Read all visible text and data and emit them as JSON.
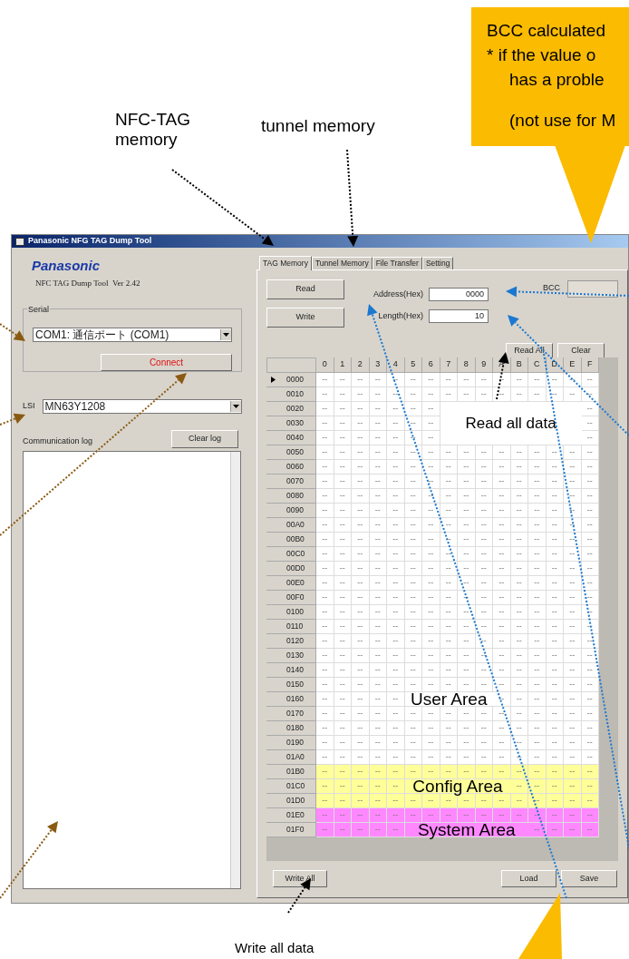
{
  "window": {
    "title": "Panasonic NFG TAG Dump Tool",
    "logo": "Panasonic",
    "version": "NFC TAG Dump Tool  Ver 2.42",
    "serial": {
      "label": "Serial",
      "port": "COM1: 通信ポート (COM1)"
    },
    "connect_button": "Connect",
    "lsi": {
      "label": "LSI",
      "value": "MN63Y1208"
    },
    "log": {
      "label": "Communication log",
      "clear_button": "Clear log"
    },
    "tabs": [
      {
        "label": "TAG Memory",
        "selected": true
      },
      {
        "label": "Tunnel Memory",
        "selected": false
      },
      {
        "label": "File Transfer",
        "selected": false
      },
      {
        "label": "Setting",
        "selected": false
      }
    ],
    "read_button": "Read",
    "write_button": "Write",
    "address": {
      "label": "Address(Hex)",
      "value": "0000"
    },
    "length": {
      "label": "Length(Hex)",
      "value": "10"
    },
    "bcc": {
      "label": "BCC"
    },
    "read_all_button": "Read All",
    "clear_button": "Clear",
    "grid": {
      "columns": [
        "0",
        "1",
        "2",
        "3",
        "4",
        "5",
        "6",
        "7",
        "8",
        "9",
        "A",
        "B",
        "C",
        "D",
        "E",
        "F"
      ],
      "rows": [
        {
          "address": "0000",
          "selected": true,
          "kind": "user",
          "cells": [
            "--",
            "--",
            "--",
            "--",
            "--",
            "--",
            "--",
            "--",
            "--",
            "--",
            "--",
            "--",
            "--",
            "--",
            "--",
            "--"
          ]
        },
        {
          "address": "0010",
          "selected": false,
          "kind": "user",
          "cells": [
            "--",
            "--",
            "--",
            "--",
            "--",
            "--",
            "--",
            "--",
            "--",
            "--",
            "--",
            "--",
            "--",
            "--",
            "--",
            "--"
          ]
        },
        {
          "address": "0020",
          "selected": false,
          "kind": "user",
          "cells": [
            "--",
            "--",
            "--",
            "--",
            "--",
            "--",
            "--",
            null,
            null,
            null,
            null,
            null,
            null,
            null,
            null,
            "--"
          ]
        },
        {
          "address": "0030",
          "selected": false,
          "kind": "user",
          "cells": [
            "--",
            "--",
            "--",
            "--",
            "--",
            "--",
            "--",
            null,
            null,
            null,
            null,
            null,
            null,
            null,
            null,
            "--"
          ]
        },
        {
          "address": "0040",
          "selected": false,
          "kind": "user",
          "cells": [
            "--",
            "--",
            "--",
            "--",
            "--",
            "--",
            "--",
            null,
            null,
            null,
            null,
            null,
            null,
            null,
            null,
            "--"
          ]
        },
        {
          "address": "0050",
          "selected": false,
          "kind": "user",
          "cells": [
            "--",
            "--",
            "--",
            "--",
            "--",
            "--",
            "--",
            "--",
            "--",
            "--",
            "--",
            "--",
            "--",
            "--",
            "--",
            "--"
          ]
        },
        {
          "address": "0060",
          "selected": false,
          "kind": "user",
          "cells": [
            "--",
            "--",
            "--",
            "--",
            "--",
            "--",
            "--",
            "--",
            "--",
            "--",
            "--",
            "--",
            "--",
            "--",
            "--",
            "--"
          ]
        },
        {
          "address": "0070",
          "selected": false,
          "kind": "user",
          "cells": [
            "--",
            "--",
            "--",
            "--",
            "--",
            "--",
            "--",
            "--",
            "--",
            "--",
            "--",
            "--",
            "--",
            "--",
            "--",
            "--"
          ]
        },
        {
          "address": "0080",
          "selected": false,
          "kind": "user",
          "cells": [
            "--",
            "--",
            "--",
            "--",
            "--",
            "--",
            "--",
            "--",
            "--",
            "--",
            "--",
            "--",
            "--",
            "--",
            "--",
            "--"
          ]
        },
        {
          "address": "0090",
          "selected": false,
          "kind": "user",
          "cells": [
            "--",
            "--",
            "--",
            "--",
            "--",
            "--",
            "--",
            "--",
            "--",
            "--",
            "--",
            "--",
            "--",
            "--",
            "--",
            "--"
          ]
        },
        {
          "address": "00A0",
          "selected": false,
          "kind": "user",
          "cells": [
            "--",
            "--",
            "--",
            "--",
            "--",
            "--",
            "--",
            "--",
            "--",
            "--",
            "--",
            "--",
            "--",
            "--",
            "--",
            "--"
          ]
        },
        {
          "address": "00B0",
          "selected": false,
          "kind": "user",
          "cells": [
            "--",
            "--",
            "--",
            "--",
            "--",
            "--",
            "--",
            "--",
            "--",
            "--",
            "--",
            "--",
            "--",
            "--",
            "--",
            "--"
          ]
        },
        {
          "address": "00C0",
          "selected": false,
          "kind": "user",
          "cells": [
            "--",
            "--",
            "--",
            "--",
            "--",
            "--",
            "--",
            "--",
            "--",
            "--",
            "--",
            "--",
            "--",
            "--",
            "--",
            "--"
          ]
        },
        {
          "address": "00D0",
          "selected": false,
          "kind": "user",
          "cells": [
            "--",
            "--",
            "--",
            "--",
            "--",
            "--",
            "--",
            "--",
            "--",
            "--",
            "--",
            "--",
            "--",
            "--",
            "--",
            "--"
          ]
        },
        {
          "address": "00E0",
          "selected": false,
          "kind": "user",
          "cells": [
            "--",
            "--",
            "--",
            "--",
            "--",
            "--",
            "--",
            "--",
            "--",
            "--",
            "--",
            "--",
            "--",
            "--",
            "--",
            "--"
          ]
        },
        {
          "address": "00F0",
          "selected": false,
          "kind": "user",
          "cells": [
            "--",
            "--",
            "--",
            "--",
            "--",
            "--",
            "--",
            "--",
            "--",
            "--",
            "--",
            "--",
            "--",
            "--",
            "--",
            "--"
          ]
        },
        {
          "address": "0100",
          "selected": false,
          "kind": "user",
          "cells": [
            "--",
            "--",
            "--",
            "--",
            "--",
            "--",
            "--",
            "--",
            "--",
            "--",
            "--",
            "--",
            "--",
            "--",
            "--",
            "--"
          ]
        },
        {
          "address": "0110",
          "selected": false,
          "kind": "user",
          "cells": [
            "--",
            "--",
            "--",
            "--",
            "--",
            "--",
            "--",
            "--",
            "--",
            "--",
            "--",
            "--",
            "--",
            "--",
            "--",
            "--"
          ]
        },
        {
          "address": "0120",
          "selected": false,
          "kind": "user",
          "cells": [
            "--",
            "--",
            "--",
            "--",
            "--",
            "--",
            "--",
            "--",
            "--",
            "--",
            "--",
            "--",
            "--",
            "--",
            "--",
            "--"
          ]
        },
        {
          "address": "0130",
          "selected": false,
          "kind": "user",
          "cells": [
            "--",
            "--",
            "--",
            "--",
            "--",
            "--",
            "--",
            "--",
            "--",
            "--",
            "--",
            "--",
            "--",
            "--",
            "--",
            "--"
          ]
        },
        {
          "address": "0140",
          "selected": false,
          "kind": "user",
          "cells": [
            "--",
            "--",
            "--",
            "--",
            "--",
            "--",
            "--",
            "--",
            "--",
            "--",
            "--",
            "--",
            "--",
            "--",
            "--",
            "--"
          ]
        },
        {
          "address": "0150",
          "selected": false,
          "kind": "user",
          "cells": [
            "--",
            "--",
            "--",
            "--",
            "--",
            "--",
            "--",
            "--",
            "--",
            "--",
            "--",
            "--",
            "--",
            "--",
            "--",
            "--"
          ]
        },
        {
          "address": "0160",
          "selected": false,
          "kind": "user",
          "cells": [
            "--",
            "--",
            "--",
            "--",
            "--",
            null,
            null,
            null,
            null,
            null,
            "--",
            "--",
            "--",
            "--",
            "--",
            "--"
          ]
        },
        {
          "address": "0170",
          "selected": false,
          "kind": "user",
          "cells": [
            "--",
            "--",
            "--",
            "--",
            "--",
            "--",
            "--",
            "--",
            "--",
            "--",
            "--",
            "--",
            "--",
            "--",
            "--",
            "--"
          ]
        },
        {
          "address": "0180",
          "selected": false,
          "kind": "user",
          "cells": [
            "--",
            "--",
            "--",
            "--",
            "--",
            "--",
            "--",
            "--",
            "--",
            "--",
            "--",
            "--",
            "--",
            "--",
            "--",
            "--"
          ]
        },
        {
          "address": "0190",
          "selected": false,
          "kind": "user",
          "cells": [
            "--",
            "--",
            "--",
            "--",
            "--",
            "--",
            "--",
            "--",
            "--",
            "--",
            "--",
            "--",
            "--",
            "--",
            "--",
            "--"
          ]
        },
        {
          "address": "01A0",
          "selected": false,
          "kind": "user",
          "cells": [
            "--",
            "--",
            "--",
            "--",
            "--",
            "--",
            "--",
            "--",
            "--",
            "--",
            "--",
            "--",
            "--",
            "--",
            "--",
            "--"
          ]
        },
        {
          "address": "01B0",
          "selected": false,
          "kind": "config",
          "cells": [
            "--",
            "--",
            "--",
            "--",
            "--",
            "--",
            "--",
            "--",
            "--",
            "--",
            "--",
            "--",
            "--",
            "--",
            "--",
            "--"
          ]
        },
        {
          "address": "01C0",
          "selected": false,
          "kind": "config",
          "cells": [
            "--",
            "--",
            "--",
            "--",
            "--",
            null,
            null,
            null,
            null,
            null,
            null,
            "--",
            "--",
            "--",
            "--",
            "--"
          ]
        },
        {
          "address": "01D0",
          "selected": false,
          "kind": "config",
          "cells": [
            "--",
            "--",
            "--",
            "--",
            "--",
            "--",
            "--",
            "--",
            "--",
            "--",
            "--",
            "--",
            "--",
            "--",
            "--",
            "--"
          ]
        },
        {
          "address": "01E0",
          "selected": false,
          "kind": "system",
          "cells": [
            "--",
            "--",
            "--",
            "--",
            "--",
            "--",
            "--",
            "--",
            "--",
            "--",
            "--",
            "--",
            "--",
            "--",
            "--",
            "--"
          ]
        },
        {
          "address": "01F0",
          "selected": false,
          "kind": "system",
          "cells": [
            "--",
            "--",
            "--",
            "--",
            "--",
            null,
            null,
            null,
            null,
            null,
            null,
            null,
            "--",
            "--",
            "--",
            "--"
          ]
        }
      ]
    },
    "write_all_button": "Write All",
    "load_button": "Load",
    "save_button": "Save"
  },
  "annotations": [
    {
      "kind": "note",
      "text": "NFC-TAG\nmemory"
    },
    {
      "kind": "note",
      "text": "tunnel memory"
    },
    {
      "kind": "callout",
      "lines": [
        "BCC calculated",
        "* if the value o",
        "has a proble",
        "(not use for M"
      ]
    },
    {
      "kind": "boxed",
      "text": "Read all data"
    },
    {
      "kind": "area",
      "text": "User Area"
    },
    {
      "kind": "area",
      "text": "Config Area"
    },
    {
      "kind": "area",
      "text": "System Area"
    },
    {
      "kind": "note",
      "text": "Write all data"
    }
  ]
}
